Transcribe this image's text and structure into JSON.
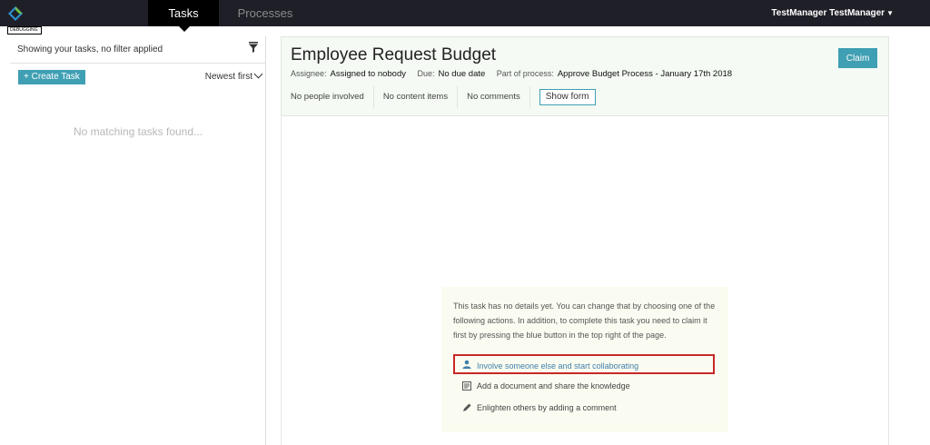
{
  "nav": {
    "tabs": [
      {
        "label": "Tasks",
        "active": true
      },
      {
        "label": "Processes",
        "active": false
      }
    ],
    "user_name": "TestManager TestManager"
  },
  "debug_tag": "DEBUGGING",
  "left": {
    "filter_text": "Showing your tasks, no filter applied",
    "create_label": "+ Create Task",
    "sort_label": "Newest first",
    "empty_message": "No matching tasks found..."
  },
  "task": {
    "title": "Employee Request Budget",
    "claim_label": "Claim",
    "assignee_label": "Assignee:",
    "assignee_value": "Assigned to nobody",
    "due_label": "Due:",
    "due_value": "No due date",
    "process_label": "Part of process:",
    "process_value": "Approve Budget Process - January 17th 2018",
    "people": "No people involved",
    "content": "No content items",
    "comments": "No comments",
    "show_form_label": "Show form"
  },
  "help": {
    "text": "This task has no details yet. You can change that by choosing one of the following actions. In addition, to complete this task you need to claim it first by pressing the blue button in the top right of the page.",
    "actions": [
      {
        "label": "Involve someone else and start collaborating",
        "icon": "user-icon"
      },
      {
        "label": "Add a document and share the knowledge",
        "icon": "document-icon"
      },
      {
        "label": "Enlighten others by adding a comment",
        "icon": "pencil-icon"
      }
    ]
  },
  "colors": {
    "accent": "#3f9fb3",
    "nav_bg": "#1f1f28",
    "header_bg": "#f5faf4",
    "highlight_border": "#c62828"
  }
}
